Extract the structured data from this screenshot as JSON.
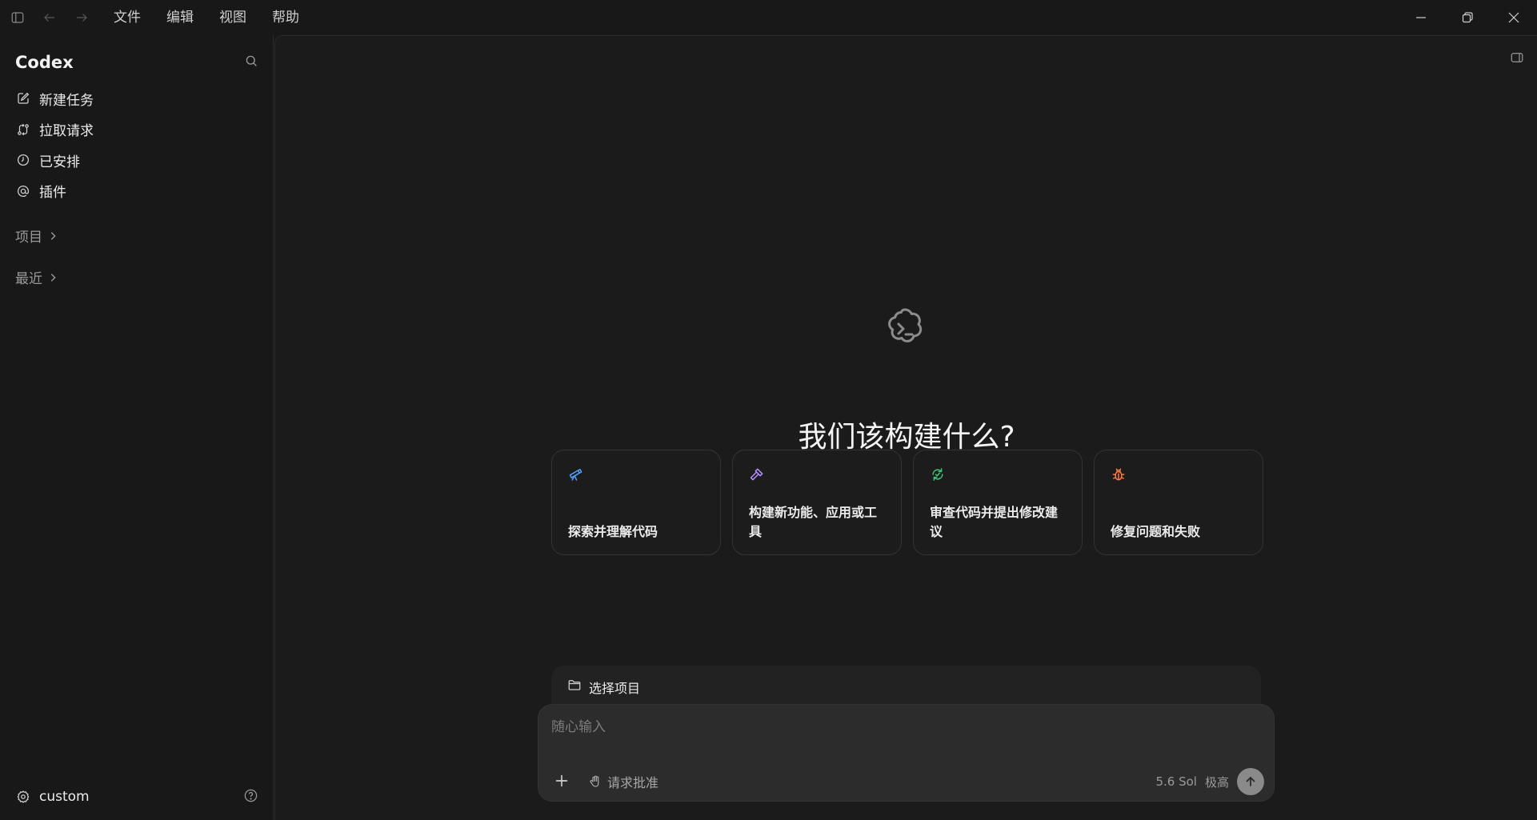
{
  "menu": {
    "items": [
      "文件",
      "编辑",
      "视图",
      "帮助"
    ]
  },
  "sidebar": {
    "title": "Codex",
    "nav": [
      {
        "label": "新建任务",
        "icon": "edit-icon"
      },
      {
        "label": "拉取请求",
        "icon": "pull-request-icon"
      },
      {
        "label": "已安排",
        "icon": "clock-icon"
      },
      {
        "label": "插件",
        "icon": "at-icon"
      }
    ],
    "sections": {
      "projects": "项目",
      "recent": "最近"
    },
    "footer": {
      "settings_label": "custom"
    }
  },
  "main": {
    "hero_title": "我们该构建什么?",
    "cards": [
      {
        "label": "探索并理解代码",
        "icon": "telescope-icon",
        "color": "#4ea1ff"
      },
      {
        "label": "构建新功能、应用或工具",
        "icon": "hammer-icon",
        "color": "#b48cff"
      },
      {
        "label": "审查代码并提出修改建议",
        "icon": "refresh-check-icon",
        "color": "#3fc47a"
      },
      {
        "label": "修复问题和失败",
        "icon": "bug-icon",
        "color": "#ff7a45"
      }
    ],
    "project_picker": "选择项目",
    "composer": {
      "placeholder": "随心输入",
      "approve_label": "请求批准",
      "model": "5.6 Sol",
      "effort": "极高"
    }
  }
}
